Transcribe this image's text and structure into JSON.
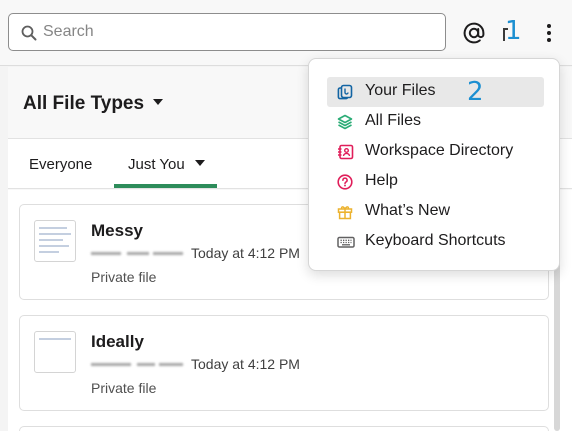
{
  "search": {
    "placeholder": "Search"
  },
  "header": {
    "mentions_icon": "at-icon",
    "more_icon": "vertical-ellipsis-icon",
    "annotation_1": "1"
  },
  "files": {
    "filter_label": "All File Types",
    "tabs": [
      {
        "label": "Everyone",
        "active": false
      },
      {
        "label": "Just You",
        "active": true
      }
    ],
    "items": [
      {
        "name": "Messy",
        "time": "Today at 4:12 PM",
        "visibility": "Private file"
      },
      {
        "name": "Ideally",
        "time": "Today at 4:12 PM",
        "visibility": "Private file"
      }
    ]
  },
  "menu": {
    "annotation_2": "2",
    "items": [
      {
        "label": "Your Files",
        "icon": "your-files-icon",
        "color": "#1264a3",
        "highlighted": true
      },
      {
        "label": "All Files",
        "icon": "layers-icon",
        "color": "#2bac76",
        "highlighted": false
      },
      {
        "label": "Workspace Directory",
        "icon": "directory-icon",
        "color": "#e01e5a",
        "highlighted": false
      },
      {
        "label": "Help",
        "icon": "help-icon",
        "color": "#e01e5a",
        "highlighted": false
      },
      {
        "label": "What’s New",
        "icon": "gift-icon",
        "color": "#ecb22e",
        "highlighted": false
      },
      {
        "label": "Keyboard Shortcuts",
        "icon": "keyboard-icon",
        "color": "#616061",
        "highlighted": false
      }
    ]
  },
  "colors": {
    "accent_green": "#2d8c5a",
    "annotation_blue": "#1c8fd1",
    "highlight": "#e8e8e8"
  }
}
